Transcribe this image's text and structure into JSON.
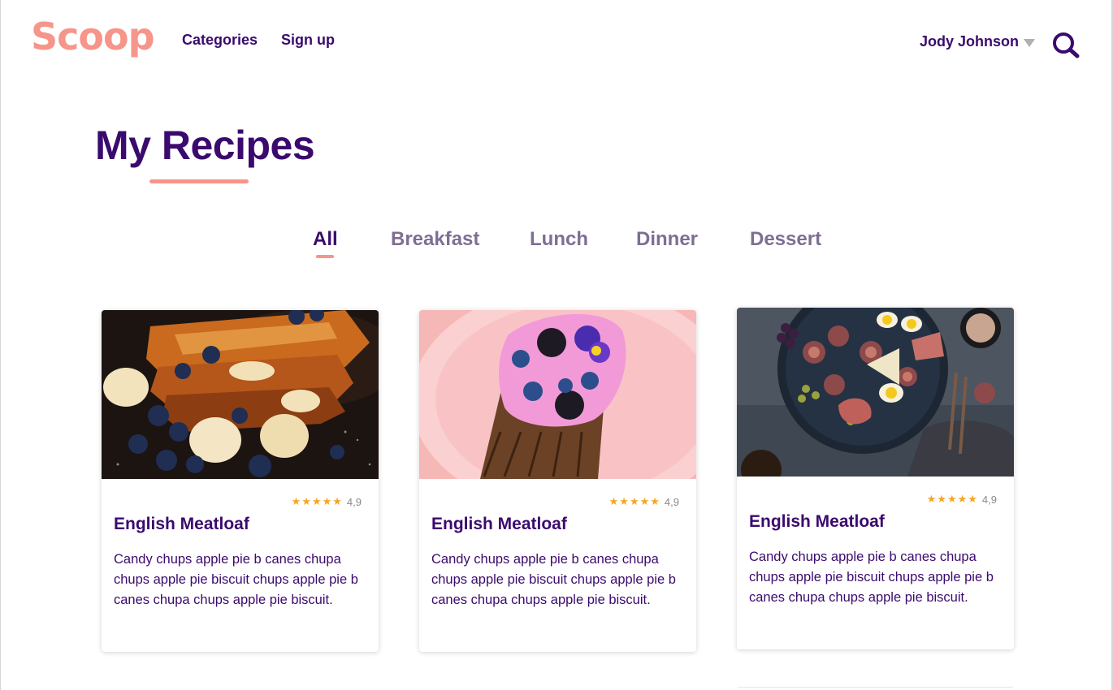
{
  "header": {
    "logo": "Scoop",
    "nav": [
      "Categories",
      "Sign up"
    ],
    "user_name": "Jody Johnson"
  },
  "page": {
    "title": "My Recipes"
  },
  "tabs": [
    "All",
    "Breakfast",
    "Lunch",
    "Dinner",
    "Dessert"
  ],
  "active_tab": "All",
  "cards": [
    {
      "title": "English Meatloaf",
      "rating": "4,9",
      "stars": 5,
      "description": "Candy chups apple pie b canes chupa chups apple pie biscuit chups apple pie b canes chupa chups apple pie biscuit.",
      "image": "french-toast-with-bananas-and-blueberries"
    },
    {
      "title": "English Meatloaf",
      "rating": "4,9",
      "stars": 5,
      "description": "Candy chups apple pie b canes chupa chups apple pie biscuit chups apple pie b canes chupa chups apple pie biscuit.",
      "image": "toast-with-pink-yogurt-and-berries"
    },
    {
      "title": "English Meatloaf",
      "rating": "4,9",
      "stars": 5,
      "description": "Candy chups apple pie b canes chupa chups apple pie biscuit chups apple pie b canes chupa chups apple pie biscuit.",
      "image": "platter-with-figs-eggs-and-cheese"
    }
  ],
  "colors": {
    "brand": "#f6958a",
    "primary_text": "#3b0a6e",
    "muted_tab": "#7f6e93",
    "star": "#f5a623"
  }
}
